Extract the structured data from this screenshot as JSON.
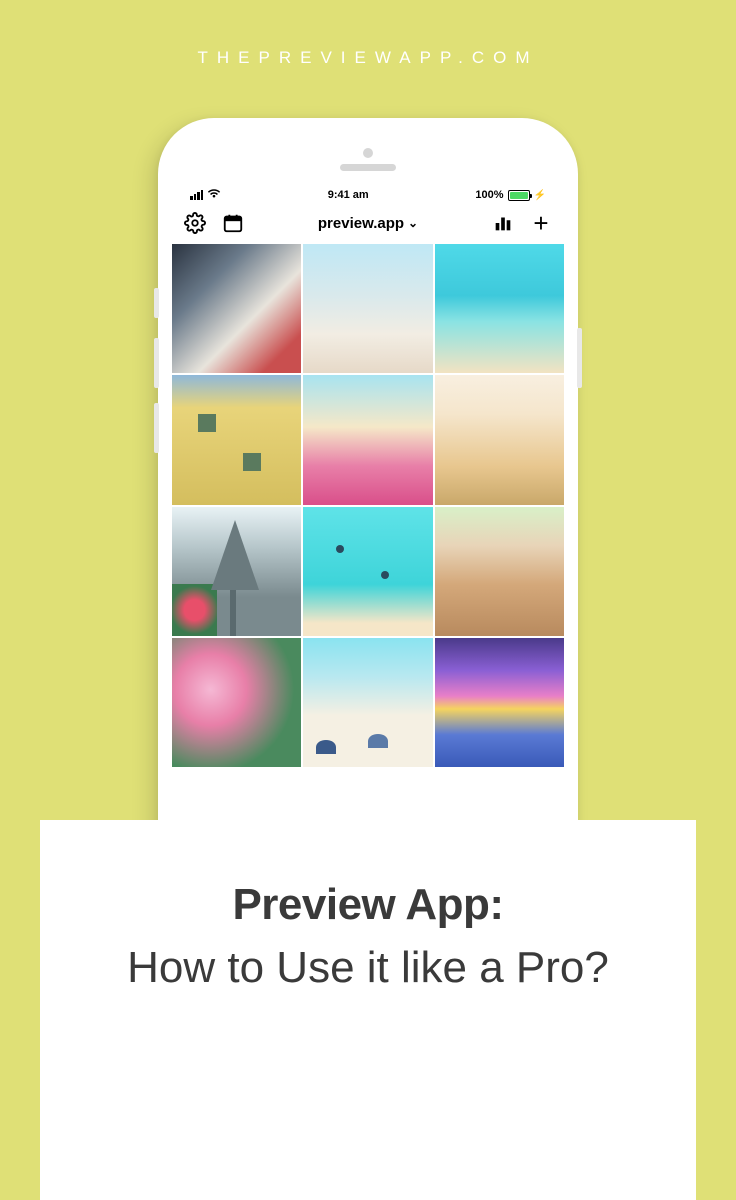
{
  "header": {
    "website": "THEPREVIEWAPP.COM"
  },
  "status_bar": {
    "time": "9:41 am",
    "battery_percent": "100%"
  },
  "toolbar": {
    "account_name": "preview.app"
  },
  "caption": {
    "title": "Preview App:",
    "subtitle": "How to Use it like a Pro?"
  }
}
